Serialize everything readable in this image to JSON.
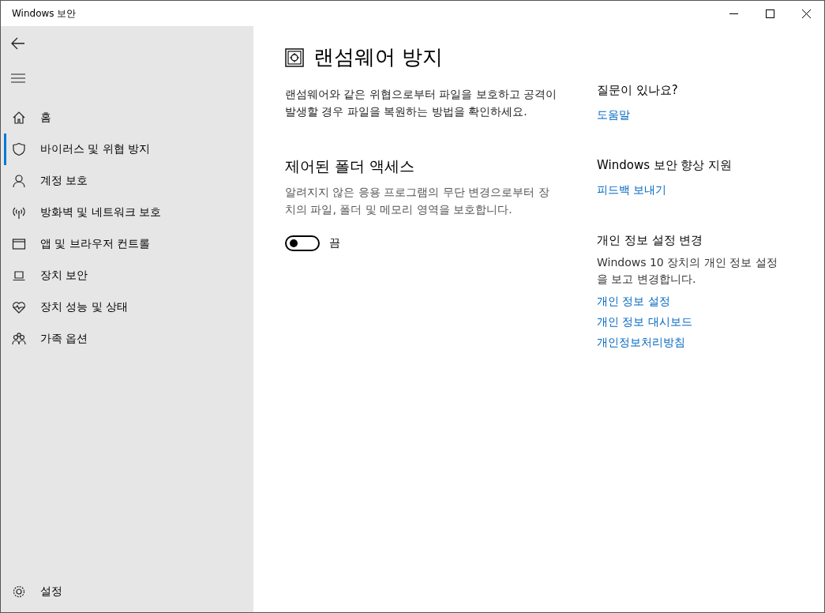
{
  "window": {
    "title": "Windows 보안"
  },
  "sidebar": {
    "items": [
      {
        "label": "홈",
        "selected": false
      },
      {
        "label": "바이러스 및 위협 방지",
        "selected": true
      },
      {
        "label": "계정 보호",
        "selected": false
      },
      {
        "label": "방화벽 및 네트워크 보호",
        "selected": false
      },
      {
        "label": "앱 및 브라우저 컨트롤",
        "selected": false
      },
      {
        "label": "장치 보안",
        "selected": false
      },
      {
        "label": "장치 성능 및 상태",
        "selected": false
      },
      {
        "label": "가족 옵션",
        "selected": false
      }
    ],
    "footer": {
      "label": "설정"
    }
  },
  "main": {
    "title": "랜섬웨어 방지",
    "description": "랜섬웨어와 같은 위협으로부터 파일을 보호하고 공격이 발생할 경우 파일을 복원하는 방법을 확인하세요.",
    "section": {
      "title": "제어된 폴더 액세스",
      "description": "알려지지 않은 응용 프로그램의 무단 변경으로부터 장치의 파일, 폴더 및 메모리 영역을 보호합니다.",
      "toggle": {
        "on": false,
        "label": "끔"
      }
    }
  },
  "aside": [
    {
      "title": "질문이 있나요?",
      "links": [
        "도움말"
      ]
    },
    {
      "title": "Windows 보안 향상 지원",
      "links": [
        "피드백 보내기"
      ]
    },
    {
      "title": "개인 정보 설정 변경",
      "text": "Windows 10 장치의 개인 정보 설정을 보고 변경합니다.",
      "links": [
        "개인 정보 설정",
        "개인 정보 대시보드",
        "개인정보처리방침"
      ]
    }
  ]
}
